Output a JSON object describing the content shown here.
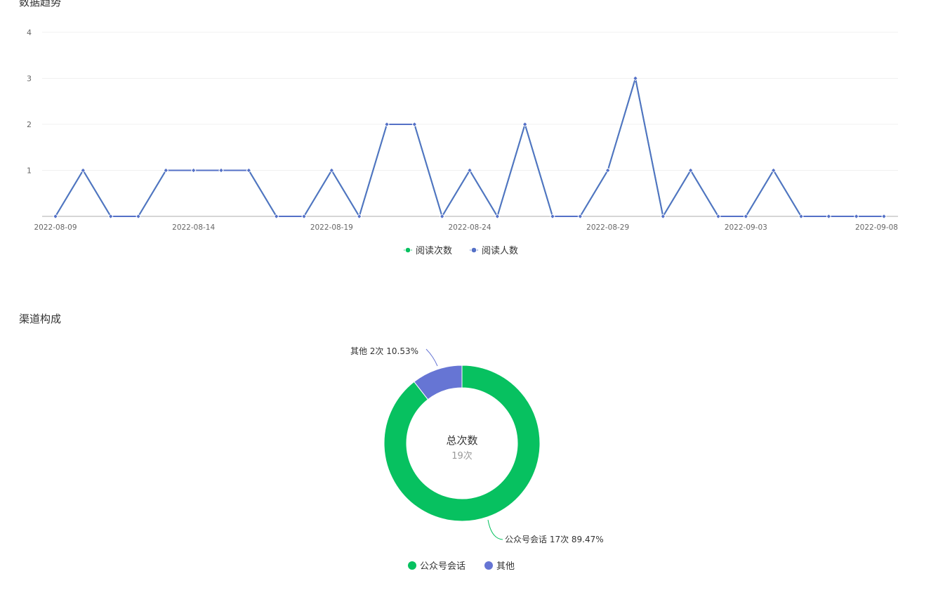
{
  "sections": {
    "trend_title": "数据趋势",
    "channel_title": "渠道构成"
  },
  "chart_data": [
    {
      "type": "line",
      "title": "数据趋势",
      "ylim": [
        0,
        4
      ],
      "yticks": [
        "1",
        "2",
        "3",
        "4"
      ],
      "grid": true,
      "legend_position": "bottom",
      "x": [
        "2022-08-09",
        "2022-08-10",
        "2022-08-11",
        "2022-08-12",
        "2022-08-13",
        "2022-08-14",
        "2022-08-15",
        "2022-08-16",
        "2022-08-17",
        "2022-08-18",
        "2022-08-19",
        "2022-08-20",
        "2022-08-21",
        "2022-08-22",
        "2022-08-23",
        "2022-08-24",
        "2022-08-25",
        "2022-08-26",
        "2022-08-27",
        "2022-08-28",
        "2022-08-29",
        "2022-08-30",
        "2022-08-31",
        "2022-09-01",
        "2022-09-02",
        "2022-09-03",
        "2022-09-04",
        "2022-09-05",
        "2022-09-06",
        "2022-09-07",
        "2022-09-08"
      ],
      "xtick_labels": [
        "2022-08-09",
        "2022-08-14",
        "2022-08-19",
        "2022-08-24",
        "2022-08-29",
        "2022-09-03",
        "2022-09-08"
      ],
      "series": [
        {
          "name": "阅读次数",
          "color": "#07c160",
          "values": [
            0,
            1,
            0,
            0,
            1,
            1,
            1,
            1,
            0,
            0,
            1,
            0,
            2,
            2,
            0,
            1,
            0,
            2,
            0,
            0,
            1,
            3,
            0,
            1,
            0,
            0,
            1,
            0,
            0,
            0,
            0
          ]
        },
        {
          "name": "阅读人数",
          "color": "#5470c6",
          "values": [
            0,
            1,
            0,
            0,
            1,
            1,
            1,
            1,
            0,
            0,
            1,
            0,
            2,
            2,
            0,
            1,
            0,
            2,
            0,
            0,
            1,
            3,
            0,
            1,
            0,
            0,
            1,
            0,
            0,
            0,
            0
          ]
        }
      ]
    },
    {
      "type": "pie",
      "title": "渠道构成",
      "center_title": "总次数",
      "center_value": "19次",
      "legend_position": "bottom",
      "slices": [
        {
          "name": "公众号会话",
          "value": 17,
          "percent": 89.47,
          "color": "#07c160",
          "label": "公众号会话 17次 89.47%"
        },
        {
          "name": "其他",
          "value": 2,
          "percent": 10.53,
          "color": "#6675d4",
          "label": "其他 2次 10.53%"
        }
      ]
    }
  ]
}
